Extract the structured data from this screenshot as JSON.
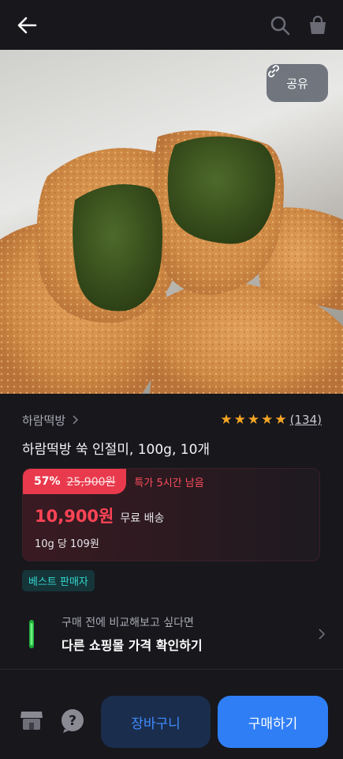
{
  "header": {
    "back_icon": "arrow-left-icon",
    "search_icon": "search-icon",
    "bag_icon": "shopping-bag-icon"
  },
  "hero": {
    "share_label": "공유",
    "share_icon": "link-icon"
  },
  "product": {
    "seller": "하람떡방",
    "rating_stars": 5,
    "review_count": "(134)",
    "title": "하람떡방 쑥 인절미, 100g, 10개"
  },
  "price": {
    "discount_percent": "57%",
    "original_price": "25,900원",
    "timer_text": "특가 5시간 남음",
    "sale_price": "10,900원",
    "shipping": "무료 배송",
    "unit_price": "10g 당 109원",
    "accent_color": "#e83a4c"
  },
  "badge": {
    "best_seller": "베스트 판매자"
  },
  "compare": {
    "subtitle": "구매 전에 비교해보고 싶다면",
    "title": "다른 쇼핑몰 가격 확인하기"
  },
  "bottom_bar": {
    "store_icon": "store-icon",
    "help_icon": "question-icon",
    "cart_label": "장바구니",
    "buy_label": "구매하기"
  }
}
